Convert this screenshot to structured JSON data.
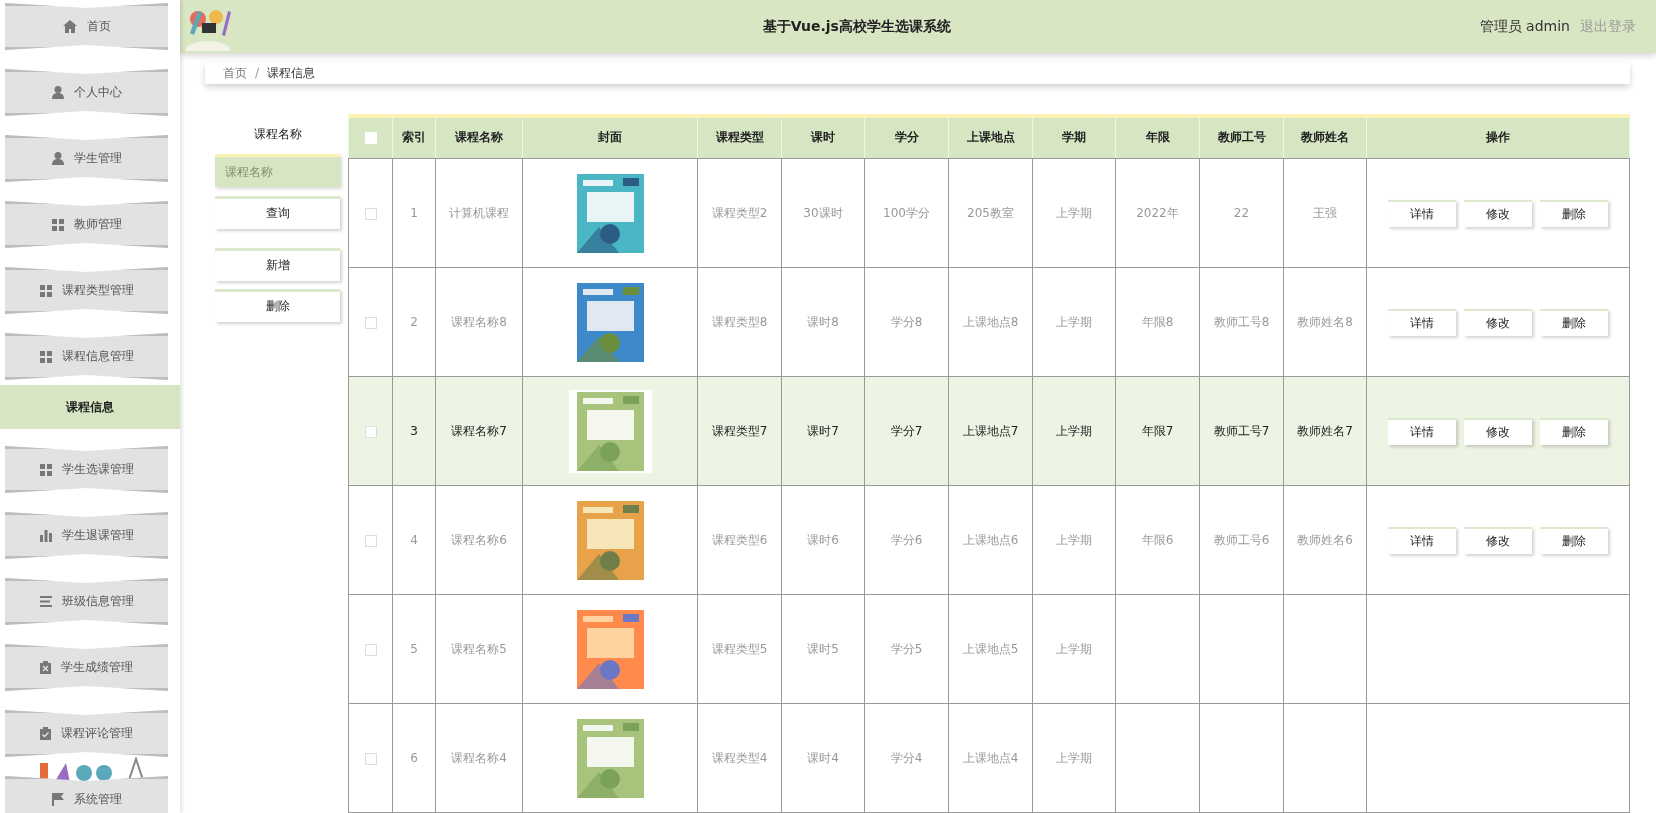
{
  "header": {
    "title": "基于Vue.js高校学生选课系统",
    "user": "管理员 admin",
    "logout": "退出登录"
  },
  "sidebar": {
    "items": [
      {
        "label": "首页",
        "selected": false
      },
      {
        "label": "个人中心",
        "selected": false
      },
      {
        "label": "学生管理",
        "selected": false
      },
      {
        "label": "教师管理",
        "selected": false
      },
      {
        "label": "课程类型管理",
        "selected": false
      },
      {
        "label": "课程信息管理",
        "selected": false,
        "children": [
          {
            "label": "课程信息",
            "selected": true
          }
        ]
      },
      {
        "label": "学生选课管理",
        "selected": false
      },
      {
        "label": "学生退课管理",
        "selected": false
      },
      {
        "label": "班级信息管理",
        "selected": false
      },
      {
        "label": "学生成绩管理",
        "selected": false
      },
      {
        "label": "课程评论管理",
        "selected": false
      },
      {
        "label": "系统管理",
        "selected": false
      }
    ]
  },
  "breadcrumb": {
    "separator": "/",
    "items": [
      "首页",
      "课程信息"
    ]
  },
  "search": {
    "label": "课程名称",
    "placeholder": "课程名称",
    "buttons": [
      "查询",
      "新增",
      "删除"
    ]
  },
  "table": {
    "select_all": {
      "checked": false
    },
    "columns": [
      "索引",
      "课程名称",
      "封面",
      "课程类型",
      "课时",
      "学分",
      "上课地点",
      "学期",
      "年限",
      "教师工号",
      "教师姓名",
      "操作"
    ],
    "rows": [
      {
        "checked": false,
        "highlighted": false,
        "cells": [
          "1",
          "计算机课程",
          {
            "kind": "picture"
          },
          "课程类型2",
          "30课时",
          "100学分",
          "205教室",
          "上学期",
          "2022年",
          "22",
          "王强"
        ],
        "actions": [
          "详情",
          "修改",
          "删除"
        ]
      },
      {
        "checked": false,
        "highlighted": false,
        "cells": [
          "2",
          "课程名称8",
          {
            "kind": "picture"
          },
          "课程类型8",
          "课时8",
          "学分8",
          "上课地点8",
          "上学期",
          "年限8",
          "教师工号8",
          "教师姓名8"
        ],
        "actions": [
          "详情",
          "修改",
          "删除"
        ]
      },
      {
        "checked": false,
        "highlighted": true,
        "cells": [
          "3",
          "课程名称7",
          {
            "kind": "picture"
          },
          "课程类型7",
          "课时7",
          "学分7",
          "上课地点7",
          "上学期",
          "年限7",
          "教师工号7",
          "教师姓名7"
        ],
        "actions": [
          "详情",
          "修改",
          "删除"
        ]
      },
      {
        "checked": false,
        "highlighted": false,
        "cells": [
          "4",
          "课程名称6",
          {
            "kind": "picture"
          },
          "课程类型6",
          "课时6",
          "学分6",
          "上课地点6",
          "上学期",
          "年限6",
          "教师工号6",
          "教师姓名6"
        ],
        "actions": [
          "详情",
          "修改",
          "删除"
        ]
      },
      {
        "checked": false,
        "highlighted": false,
        "cells": [
          "5",
          "课程名称5",
          {
            "kind": "picture"
          },
          "课程类型5",
          "课时5",
          "学分5",
          "上课地点5",
          "上学期"
        ]
      },
      {
        "checked": false,
        "highlighted": false,
        "cells": [
          "6",
          "课程名称4",
          {
            "kind": "picture"
          },
          "课程类型4",
          "课时4",
          "学分4",
          "上课地点4",
          "上学期"
        ]
      }
    ]
  }
}
